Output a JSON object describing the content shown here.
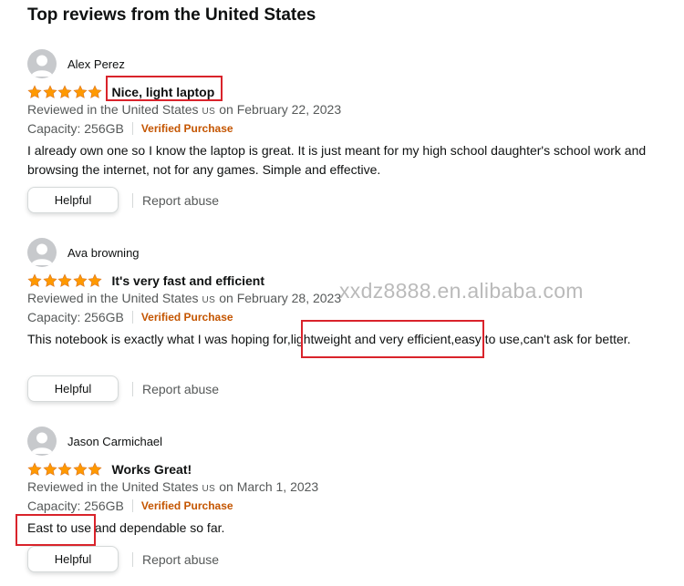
{
  "page": {
    "title": "Top reviews from the United States"
  },
  "reviews": [
    {
      "reviewer": "Alex Perez",
      "rating": 5,
      "title": "Nice, light laptop",
      "date_prefix": "Reviewed in the United States",
      "country_code": "US",
      "date_suffix": "on February 22, 2023",
      "capacity": "Capacity: 256GB",
      "verified": "Verified Purchase",
      "body": "I already own one so I know the laptop is great. It is just meant for my high school daughter's school work and browsing the internet, not for any games. Simple and effective.",
      "helpful_label": "Helpful",
      "report_label": "Report abuse"
    },
    {
      "reviewer": "Ava browning",
      "rating": 5,
      "title": "It's very fast and efficient",
      "date_prefix": "Reviewed in the United States",
      "country_code": "US",
      "date_suffix": "on February 28, 2023",
      "capacity": "Capacity: 256GB",
      "verified": "Verified Purchase",
      "body": "This notebook is exactly what I was hoping for,lightweight and very efficient,easy to use,can't ask for better.",
      "helpful_label": "Helpful",
      "report_label": "Report abuse"
    },
    {
      "reviewer": "Jason Carmichael",
      "rating": 5,
      "title": "Works Great!",
      "date_prefix": "Reviewed in the United States",
      "country_code": "US",
      "date_suffix": "on March 1, 2023",
      "capacity": "Capacity: 256GB",
      "verified": "Verified Purchase",
      "body": "East to use and dependable so far.",
      "helpful_label": "Helpful",
      "report_label": "Report abuse"
    }
  ],
  "watermark": "xxdz8888.en.alibaba.com",
  "colors": {
    "star": "#ff9900",
    "star_outline": "#de7921",
    "verified": "#c45500",
    "meta_text": "#565959",
    "annotation": "#d9232b"
  },
  "icons": {
    "avatar": "default-avatar-icon",
    "star": "star-icon"
  }
}
